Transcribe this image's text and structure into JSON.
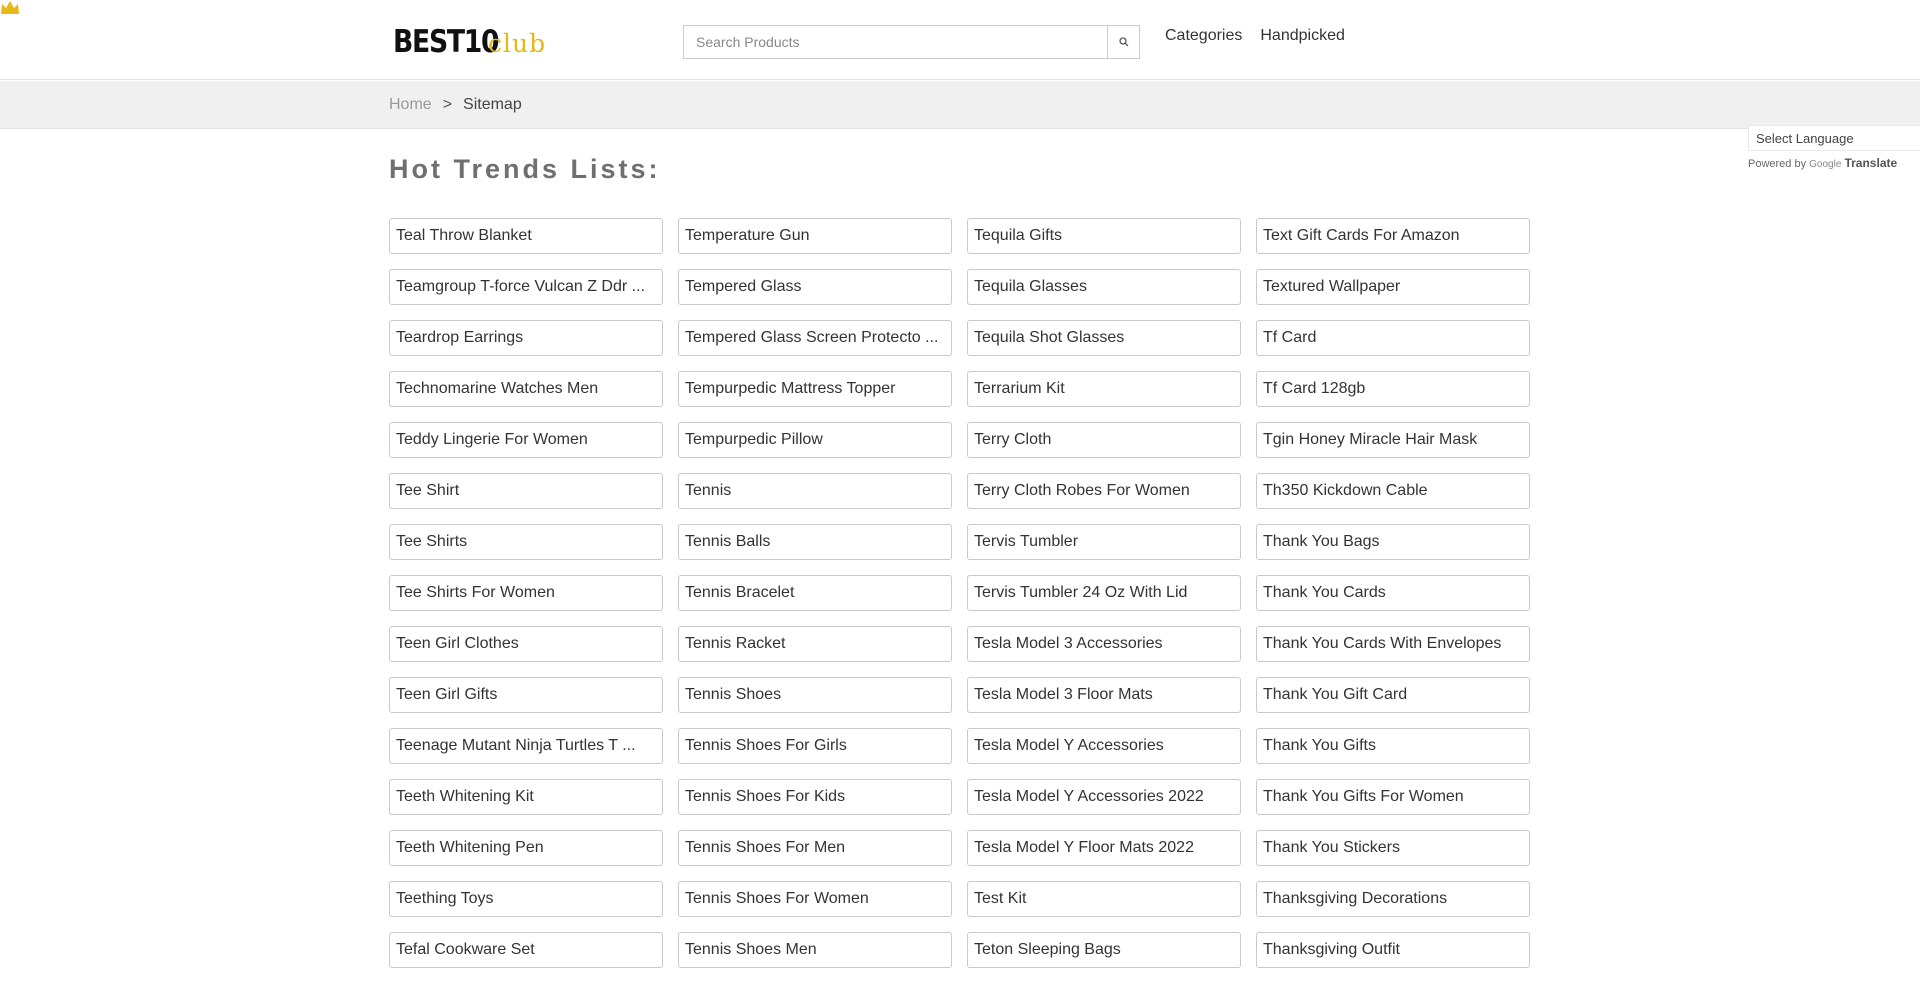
{
  "header": {
    "logo_main": "BEST10",
    "logo_sub": "club",
    "search_placeholder": "Search Products",
    "nav": [
      "Categories",
      "Handpicked"
    ]
  },
  "breadcrumb": {
    "home": "Home",
    "separator": ">",
    "current": "Sitemap"
  },
  "translate": {
    "select_label": "Select Language",
    "powered_by": "Powered by",
    "google": "Google",
    "translate": "Translate"
  },
  "page_title": "Hot Trends Lists:",
  "colors": {
    "accent": "#e6b818",
    "title": "#6f6f6f",
    "crumb_bg": "#f0f0f0"
  },
  "icons": {
    "search": "search-icon",
    "crown": "crown-icon"
  },
  "items": [
    "Teal Throw Blanket",
    "Temperature Gun",
    "Tequila Gifts",
    "Text Gift Cards For Amazon",
    "Teamgroup T-force Vulcan Z Ddr ...",
    "Tempered Glass",
    "Tequila Glasses",
    "Textured Wallpaper",
    "Teardrop Earrings",
    "Tempered Glass Screen Protecto ...",
    "Tequila Shot Glasses",
    "Tf Card",
    "Technomarine Watches Men",
    "Tempurpedic Mattress Topper",
    "Terrarium Kit",
    "Tf Card 128gb",
    "Teddy Lingerie For Women",
    "Tempurpedic Pillow",
    "Terry Cloth",
    "Tgin Honey Miracle Hair Mask",
    "Tee Shirt",
    "Tennis",
    "Terry Cloth Robes For Women",
    "Th350 Kickdown Cable",
    "Tee Shirts",
    "Tennis Balls",
    "Tervis Tumbler",
    "Thank You Bags",
    "Tee Shirts For Women",
    "Tennis Bracelet",
    "Tervis Tumbler 24 Oz With Lid",
    "Thank You Cards",
    "Teen Girl Clothes",
    "Tennis Racket",
    "Tesla Model 3 Accessories",
    "Thank You Cards With Envelopes",
    "Teen Girl Gifts",
    "Tennis Shoes",
    "Tesla Model 3 Floor Mats",
    "Thank You Gift Card",
    "Teenage Mutant Ninja Turtles T ...",
    "Tennis Shoes For Girls",
    "Tesla Model Y Accessories",
    "Thank You Gifts",
    "Teeth Whitening Kit",
    "Tennis Shoes For Kids",
    "Tesla Model Y Accessories 2022",
    "Thank You Gifts For Women",
    "Teeth Whitening Pen",
    "Tennis Shoes For Men",
    "Tesla Model Y Floor Mats 2022",
    "Thank You Stickers",
    "Teething Toys",
    "Tennis Shoes For Women",
    "Test Kit",
    "Thanksgiving Decorations",
    "Tefal Cookware Set",
    "Tennis Shoes Men",
    "Teton Sleeping Bags",
    "Thanksgiving Outfit"
  ]
}
